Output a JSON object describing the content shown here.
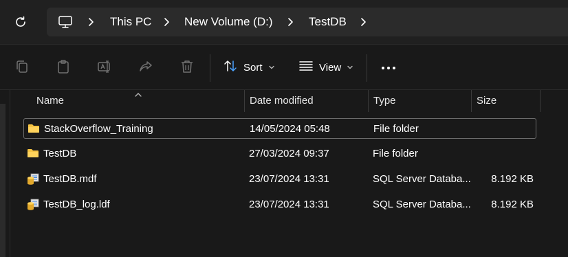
{
  "breadcrumb": [
    "This PC",
    "New Volume (D:)",
    "TestDB"
  ],
  "toolbar": {
    "sort_label": "Sort",
    "view_label": "View"
  },
  "columns": {
    "name": "Name",
    "date": "Date modified",
    "type": "Type",
    "size": "Size"
  },
  "rows": [
    {
      "name": "StackOverflow_Training",
      "date": "14/05/2024 05:48",
      "type": "File folder",
      "size": "",
      "icon": "folder-icon"
    },
    {
      "name": "TestDB",
      "date": "27/03/2024 09:37",
      "type": "File folder",
      "size": "",
      "icon": "folder-icon"
    },
    {
      "name": "TestDB.mdf",
      "date": "23/07/2024 13:31",
      "type": "SQL Server Databa...",
      "size": "8.192 KB",
      "icon": "database-file-icon"
    },
    {
      "name": "TestDB_log.ldf",
      "date": "23/07/2024 13:31",
      "type": "SQL Server Databa...",
      "size": "8.192 KB",
      "icon": "database-file-icon"
    }
  ],
  "colors": {
    "folder": "#f6c443",
    "accent": "#4aa3ff"
  }
}
